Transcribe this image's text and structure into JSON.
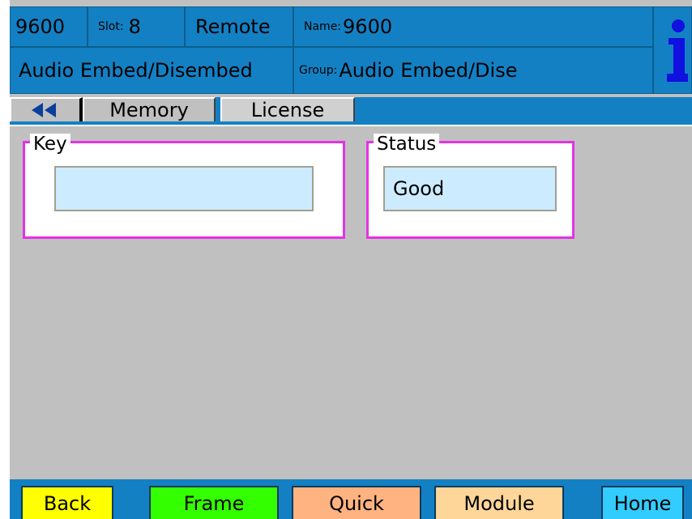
{
  "header": {
    "device": "9600",
    "slot_label": "Slot:",
    "slot_value": "8",
    "mode": "Remote",
    "name_label": "Name:",
    "name_value": "9600",
    "module": "Audio Embed/Disembed",
    "group_label": "Group:",
    "group_value": "Audio Embed/Dise",
    "info_icon": "info-icon"
  },
  "tabs": {
    "prev_icon": "double-left-arrow-icon",
    "items": [
      {
        "label": "Memory"
      },
      {
        "label": "License"
      }
    ]
  },
  "key_group": {
    "title": "Key",
    "value": ""
  },
  "status_group": {
    "title": "Status",
    "value": "Good"
  },
  "footer": {
    "back": "Back",
    "frame": "Frame",
    "quick": "Quick",
    "module": "Module",
    "home": "Home"
  },
  "colors": {
    "header_bg": "#1480c4",
    "group_border": "#e632e6",
    "field_bg": "#ccebff",
    "back_btn": "#ffff00",
    "frame_btn": "#33ff00",
    "quick_btn": "#ffb380",
    "module_btn": "#ffd699",
    "home_btn": "#33ccff"
  }
}
